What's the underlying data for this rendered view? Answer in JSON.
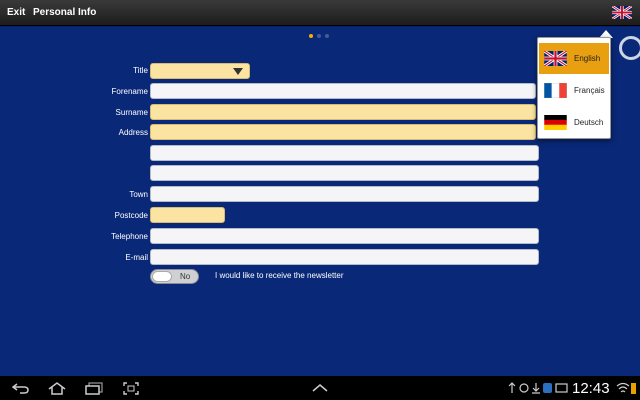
{
  "topbar": {
    "exit_label": "Exit",
    "title": "Personal Info",
    "flag_icon": "uk-flag-icon"
  },
  "form": {
    "title_label": "Title",
    "title_value": "",
    "forename_label": "Forename",
    "surname_label": "Surname",
    "address_label": "Address",
    "town_label": "Town",
    "postcode_label": "Postcode",
    "telephone_label": "Telephone",
    "email_label": "E-mail",
    "newsletter_toggle": "No",
    "newsletter_label": "I would like to receive the newsletter"
  },
  "language_menu": {
    "items": [
      {
        "label": "English",
        "icon": "uk-flag-icon",
        "selected": true
      },
      {
        "label": "Français",
        "icon": "france-flag-icon",
        "selected": false
      },
      {
        "label": "Deutsch",
        "icon": "germany-flag-icon",
        "selected": false
      }
    ]
  },
  "status_bar": {
    "time": "12:43"
  },
  "colors": {
    "background": "#0a2878",
    "required_field": "#fbe3a2",
    "selected_language": "#e9a010"
  }
}
